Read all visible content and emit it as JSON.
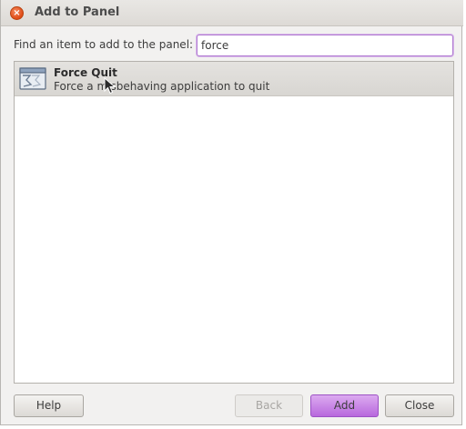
{
  "window": {
    "title": "Add to Panel",
    "close_glyph": "×"
  },
  "search": {
    "label": "Find an item to add to the panel:",
    "value": "force"
  },
  "items": [
    {
      "name": "Force Quit",
      "description": "Force a misbehaving application to quit",
      "icon": "force-quit-icon"
    }
  ],
  "buttons": {
    "help": "Help",
    "back": "Back",
    "add": "Add",
    "close": "Close"
  },
  "colors": {
    "accent": "#b868dd",
    "close_button": "#df4b16",
    "selection": "#dcdad6"
  }
}
